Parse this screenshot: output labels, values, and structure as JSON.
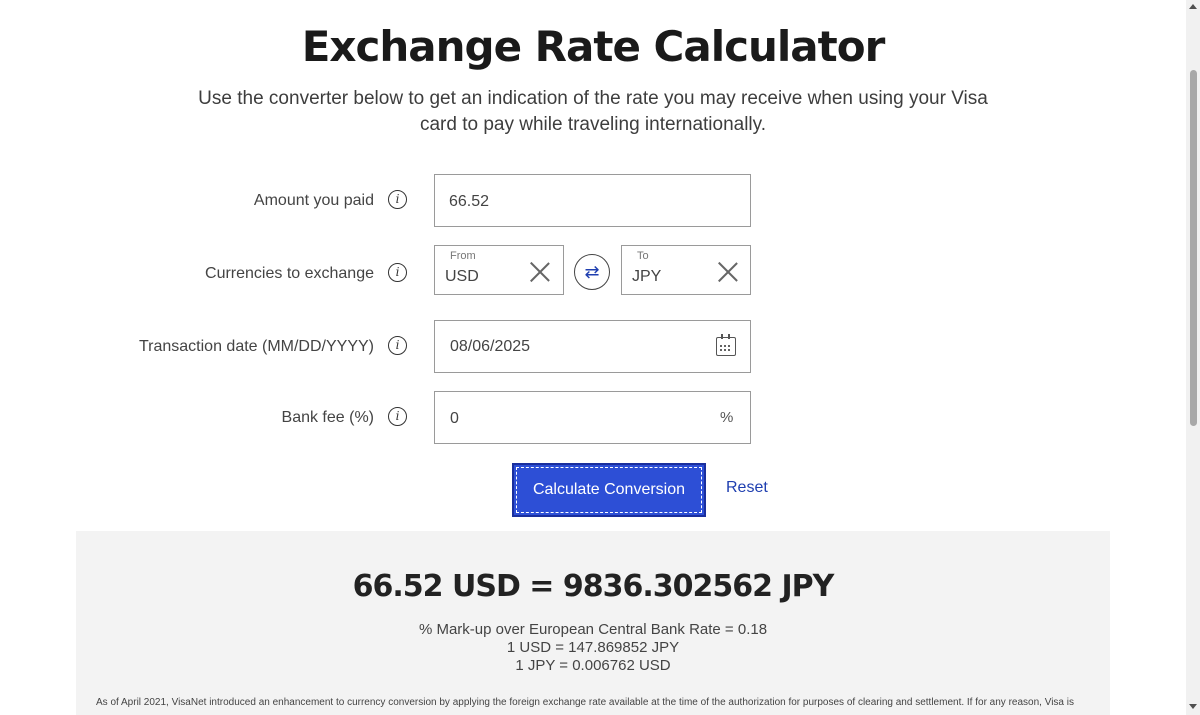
{
  "page": {
    "title": "Exchange Rate Calculator",
    "subtitle": "Use the converter below to get an indication of the rate you may receive when using your Visa card to pay while traveling internationally."
  },
  "form": {
    "amount": {
      "label": "Amount you paid",
      "value": "66.52"
    },
    "currencies": {
      "label": "Currencies to exchange",
      "from_label": "From",
      "from_value": "USD",
      "to_label": "To",
      "to_value": "JPY"
    },
    "date": {
      "label": "Transaction date (MM/DD/YYYY)",
      "value": "08/06/2025"
    },
    "fee": {
      "label": "Bank fee (%)",
      "value": "0",
      "suffix": "%"
    },
    "info_glyph": "i",
    "swap_glyph": "⇄"
  },
  "actions": {
    "calculate_label": "Calculate Conversion",
    "reset_label": "Reset"
  },
  "result": {
    "main": "66.52 USD = 9836.302562 JPY",
    "markup": "% Mark-up over European Central Bank Rate = 0.18",
    "rate_from": "1 USD = 147.869852 JPY",
    "rate_to": "1 JPY = 0.006762 USD",
    "disclaimer": "As of April 2021, VisaNet introduced an enhancement to currency conversion by applying the foreign exchange rate available at the time of the authorization for purposes of clearing and settlement. If for any reason, Visa is"
  },
  "icons": {
    "info": "info-icon",
    "swap": "swap-icon",
    "clear": "close-icon",
    "calendar": "calendar-icon"
  },
  "colors": {
    "accent": "#2d4fd6",
    "link": "#1f3fb0",
    "panel_bg": "#f3f3f3"
  }
}
